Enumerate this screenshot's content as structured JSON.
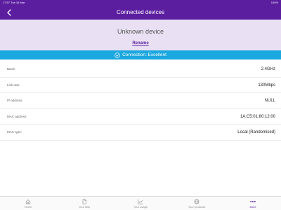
{
  "status_bar": {
    "time": "17:57",
    "date": "Tue 16 Mar",
    "battery": "100%"
  },
  "nav": {
    "title": "Connected devices",
    "back_icon": "chevron-left-icon"
  },
  "device": {
    "name": "Unknown device",
    "rename_label": "Rename"
  },
  "connection": {
    "label": "Connection: Excellent",
    "icon": "check-circle-icon",
    "color": "#1ba7df"
  },
  "details": [
    {
      "label": "Band:",
      "value": "2.4GHz"
    },
    {
      "label": "Link rate:",
      "value": "130Mbps"
    },
    {
      "label": "IP address:",
      "value": "NULL"
    },
    {
      "label": "MAC address:",
      "value": "1A:C5:01:80:12:00"
    },
    {
      "label": "MAC type:",
      "value": "Local (Randomised)"
    }
  ],
  "tabs": [
    {
      "label": "Home",
      "icon": "home-icon"
    },
    {
      "label": "Your bills",
      "icon": "document-icon"
    },
    {
      "label": "Your usage",
      "icon": "chart-line-icon"
    },
    {
      "label": "Your products",
      "icon": "globe-icon"
    },
    {
      "label": "More",
      "icon": "more-dots-icon",
      "active": true
    }
  ],
  "colors": {
    "brand": "#5b1e9f",
    "header_bg": "#e9e1f3",
    "banner": "#1ba7df"
  }
}
